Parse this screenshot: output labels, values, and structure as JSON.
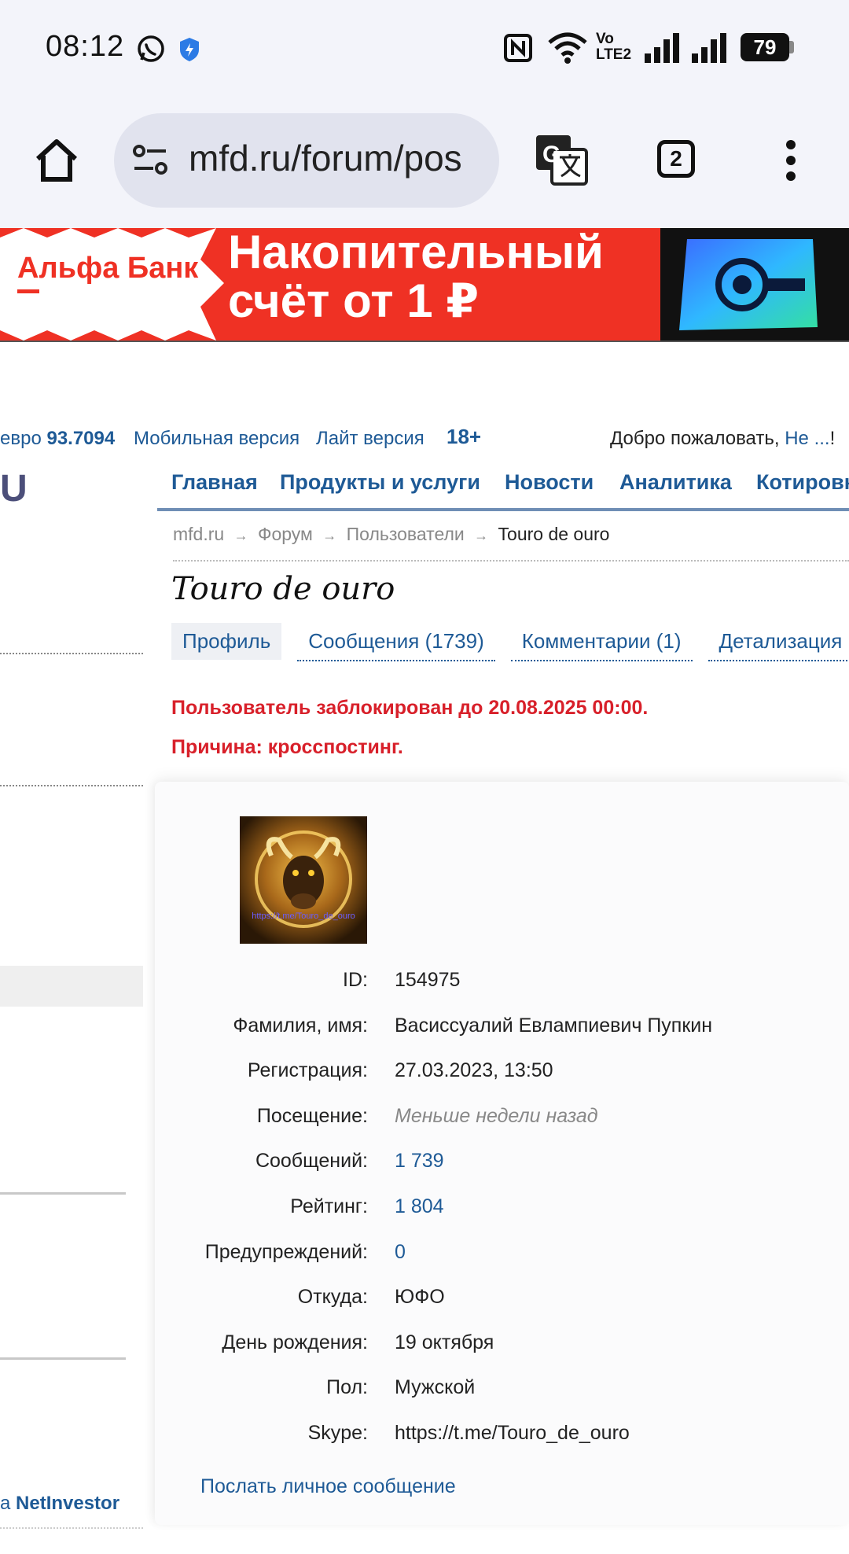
{
  "status": {
    "time": "08:12",
    "battery": "79",
    "net_label_top": "Vo",
    "net_label_bottom": "LTE2"
  },
  "browser": {
    "url": "mfd.ru/forum/pos",
    "tabs_count": "2"
  },
  "banner": {
    "brand": "Альфа Банк",
    "line1": "Накопительный",
    "line2": "счёт от 1 ₽",
    "accent_color": "#ef3124"
  },
  "topline": {
    "rate_label": "евро",
    "rate_value": "93.7094",
    "mobile": "Мобильная версия",
    "lite": "Лайт версия",
    "age": "18+",
    "welcome": "Добро пожаловать, ",
    "user_link": "Не ...",
    "exclaim": "!"
  },
  "left": {
    "logo_fragment": "U",
    "bottom_prefix": "а ",
    "bottom_link": "NetInvestor"
  },
  "nav": {
    "items": [
      "Главная",
      "Продукты и услуги",
      "Новости",
      "Аналитика",
      "Котировк"
    ]
  },
  "breadcrumb": {
    "items": [
      "mfd.ru",
      "Форум",
      "Пользователи",
      "Touro de ouro"
    ],
    "sep": "→"
  },
  "profile": {
    "title": "Touro de ouro",
    "tabs": [
      "Профиль",
      "Сообщения (1739)",
      "Комментарии (1)",
      "Детализация ре"
    ],
    "alert_line1": "Пользователь заблокирован до 20.08.2025 00:00.",
    "alert_line2": "Причина: кросспостинг.",
    "avatar_caption": "https://t.me/Touro_de_ouro",
    "fields": [
      {
        "label": "ID:",
        "value": "154975"
      },
      {
        "label": "Фамилия, имя:",
        "value": "Васиссуалий Евлампиевич Пупкин"
      },
      {
        "label": "Регистрация:",
        "value": "27.03.2023, 13:50"
      },
      {
        "label": "Посещение:",
        "value": "Меньше недели назад"
      },
      {
        "label": "Сообщений:",
        "value": "1 739"
      },
      {
        "label": "Рейтинг:",
        "value": "1 804"
      },
      {
        "label": "Предупреждений:",
        "value": "0"
      },
      {
        "label": "Откуда:",
        "value": "ЮФО"
      },
      {
        "label": "День рождения:",
        "value": "19 октября"
      },
      {
        "label": "Пол:",
        "value": "Мужской"
      },
      {
        "label": "Skype:",
        "value": "https://t.me/Touro_de_ouro"
      }
    ],
    "pm_link": "Послать личное сообщение"
  }
}
